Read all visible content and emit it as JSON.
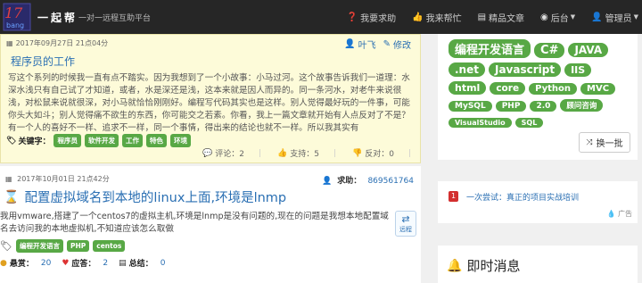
{
  "navbar": {
    "brand": "一起帮",
    "slogan": "一对一远程互助平台",
    "links": [
      {
        "icon": "question-icon",
        "label": "我要求助"
      },
      {
        "icon": "thumbs-up-icon",
        "label": "我来帮忙"
      },
      {
        "icon": "book-icon",
        "label": "精品文章"
      },
      {
        "icon": "dashboard-icon",
        "label": "后台"
      },
      {
        "icon": "user-icon",
        "label": "管理员"
      }
    ]
  },
  "article": {
    "datetime": "2017年09月27日 21点04分",
    "author": "叶飞",
    "edit": "修改",
    "title": "程序员的工作",
    "body": "写这个系列的时候我一直有点不踏实。因为我想到了一个小故事：小马过河。这个故事告诉我们一道理：水深水浅只有自己试了才知道，或者，水是深还是浅，这本来就是因人而异的。同一条河水，对老牛来说很浅，对松鼠来说就很深，对小马就恰恰刚刚好。编程写代码其实也是这样。别人觉得最好玩的一件事，可能你头大如斗；别人觉得痛不欲生的东西，你可能交之若素。你看，我上一篇文章就开始有人点反对了不是？有一个人的喜好不一样、追求不一样，同一个事情，得出来的结论也就不一样。所以我其实有",
    "keyword_label": "关键字：",
    "keywords": [
      "程序员",
      "软件开发",
      "工作",
      "特色",
      "环境"
    ],
    "stats": {
      "comment": "评论：2",
      "support": "支持：5",
      "oppose": "反对：0"
    }
  },
  "request": {
    "datetime": "2017年10月01日 21点42分",
    "reward_label": "求助：",
    "reward_value": "869561764",
    "title": "配置虚拟域名到本地的linux上面,环境是lnmp",
    "body": "我用vmware,搭建了一个centos7的虚拟主机,环境是lnmp是没有问题的,现在的问题是我想本地配置域名去访问我的本地虚拟机,不知道应该怎么取做",
    "remote_label": "远程",
    "tags": [
      "编程开发语言",
      "PHP",
      "centos"
    ],
    "stats": {
      "bounty_label": "悬赏：",
      "bounty": "20",
      "answer_label": "应答：",
      "answer": "2",
      "summary_label": "总结：",
      "summary": "0"
    }
  },
  "sidebar": {
    "tags": [
      {
        "label": "编程开发语言",
        "size": 13
      },
      {
        "label": "C#",
        "size": 13
      },
      {
        "label": "JAVA",
        "size": 12
      },
      {
        "label": ".net",
        "size": 12
      },
      {
        "label": "Javascript",
        "size": 12
      },
      {
        "label": "IIS",
        "size": 11
      },
      {
        "label": "html",
        "size": 11
      },
      {
        "label": "core",
        "size": 10.5
      },
      {
        "label": "Python",
        "size": 10
      },
      {
        "label": "MVC",
        "size": 10
      },
      {
        "label": "MySQL",
        "size": 9
      },
      {
        "label": "PHP",
        "size": 9
      },
      {
        "label": "2.0",
        "size": 9
      },
      {
        "label": "顾问咨询",
        "size": 8.5
      },
      {
        "label": "VisualStudio",
        "size": 8
      },
      {
        "label": "SQL",
        "size": 8
      }
    ],
    "swap_label": "换一批",
    "promo_number": "1",
    "promo_text": "一次尝试：真正的项目实战培训",
    "ad_label": "广告",
    "notice_title": "即时消息"
  },
  "colors": {
    "accent": "#2a6fb3",
    "tag": "#58a845",
    "highlight": "#fdfbd9"
  }
}
